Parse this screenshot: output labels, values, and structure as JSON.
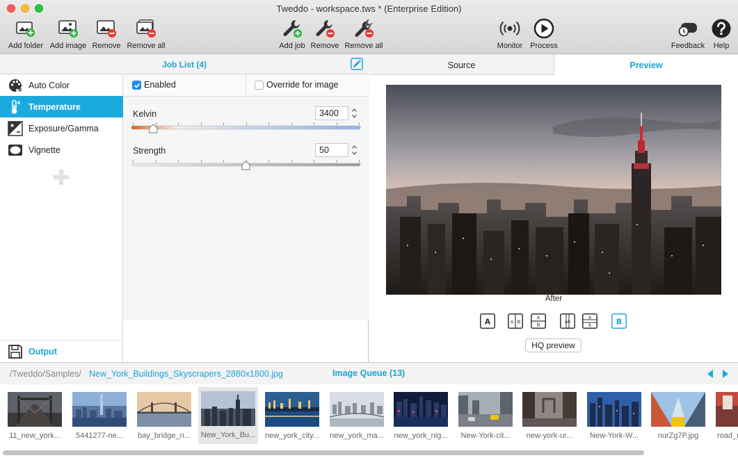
{
  "window": {
    "title": "Tweddo - workspace.tws * (Enterprise Edition)"
  },
  "toolbar": {
    "add_folder": "Add folder",
    "add_image": "Add image",
    "remove": "Remove",
    "remove_all": "Remove all",
    "add_job": "Add job",
    "remove_job": "Remove",
    "remove_all_jobs": "Remove all",
    "monitor": "Monitor",
    "process": "Process",
    "feedback": "Feedback",
    "help": "Help"
  },
  "job_panel": {
    "title": "Job List (4)",
    "jobs": [
      {
        "label": "Auto Color",
        "icon": "palette-icon",
        "selected": false
      },
      {
        "label": "Temperature",
        "icon": "thermometer-icon",
        "selected": true
      },
      {
        "label": "Exposure/Gamma",
        "icon": "exposure-icon",
        "selected": false
      },
      {
        "label": "Vignette",
        "icon": "vignette-icon",
        "selected": false
      }
    ],
    "output_label": "Output"
  },
  "settings": {
    "enabled_label": "Enabled",
    "enabled": true,
    "override_label": "Override for image",
    "override": false,
    "kelvin_label": "Kelvin",
    "kelvin_value": "3400",
    "kelvin_fraction": 0.08,
    "strength_label": "Strength",
    "strength_value": "50",
    "strength_fraction": 0.5
  },
  "preview": {
    "tab_source": "Source",
    "tab_preview": "Preview",
    "after_label": "After",
    "mode_a": "A",
    "mode_b": "B",
    "hq_button": "HQ preview"
  },
  "queue": {
    "path_base": "/Tweddo/Samples/",
    "path_file": "New_York_Buildings_Skyscrapers_2880x1800.jpg",
    "title": "Image Queue (13)",
    "items": [
      {
        "caption": "11_new_york..."
      },
      {
        "caption": "5441277-ne..."
      },
      {
        "caption": "bay_bridge_n..."
      },
      {
        "caption": "New_York_Bu..."
      },
      {
        "caption": "new_york_city..."
      },
      {
        "caption": "new_york_ma..."
      },
      {
        "caption": "new_york_nig..."
      },
      {
        "caption": "New-York-cit..."
      },
      {
        "caption": "new-york-ur..."
      },
      {
        "caption": "New-York-W..."
      },
      {
        "caption": "nurZg7P.jpg"
      },
      {
        "caption": "road_n"
      }
    ]
  },
  "colors": {
    "accent": "#1ba9df",
    "selection": "#1ba9df"
  }
}
